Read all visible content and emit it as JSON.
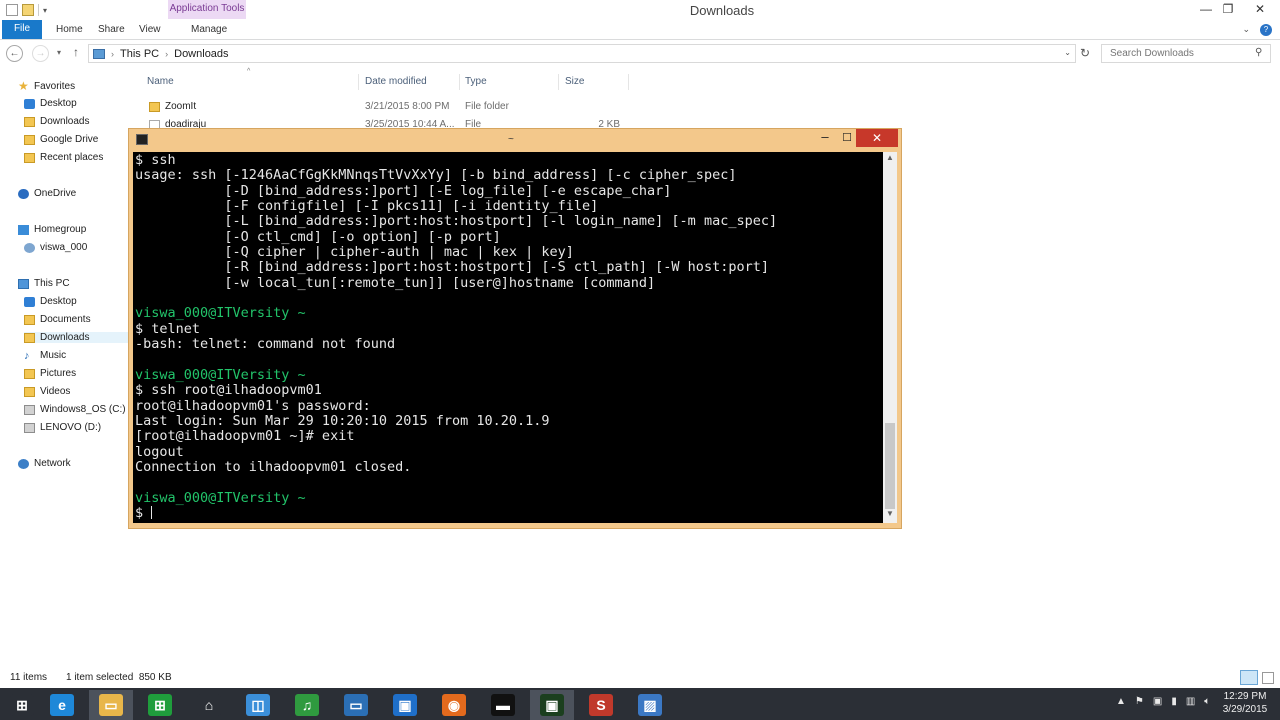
{
  "explorer": {
    "title": "Downloads",
    "contextual_tab": "Application Tools",
    "ribbon_tabs": [
      "File",
      "Home",
      "Share",
      "View",
      "Manage"
    ],
    "address": {
      "crumbs": [
        "This PC",
        "Downloads"
      ]
    },
    "search_placeholder": "Search Downloads",
    "nav": {
      "favorites": "Favorites",
      "fav_items": [
        "Desktop",
        "Downloads",
        "Google Drive",
        "Recent places"
      ],
      "onedrive": "OneDrive",
      "homegroup": "Homegroup",
      "homegroup_items": [
        "viswa_000"
      ],
      "thispc": "This PC",
      "pc_items": [
        "Desktop",
        "Documents",
        "Downloads",
        "Music",
        "Pictures",
        "Videos",
        "Windows8_OS (C:)",
        "LENOVO (D:)"
      ],
      "network": "Network"
    },
    "columns": [
      "Name",
      "Date modified",
      "Type",
      "Size"
    ],
    "rows": [
      {
        "name": "ZoomIt",
        "date": "3/21/2015 8:00 PM",
        "type": "File folder",
        "size": ""
      },
      {
        "name": "doadiraju",
        "date": "3/25/2015 10:44 A...",
        "type": "File",
        "size": "2 KB"
      }
    ],
    "status": {
      "count": "11 items",
      "selected": "1 item selected  850 KB"
    }
  },
  "terminal": {
    "title": "~",
    "lines": [
      {
        "text": "$ ssh",
        "color": "white"
      },
      {
        "text": "usage: ssh [-1246AaCfGgKkMNnqsTtVvXxYy] [-b bind_address] [-c cipher_spec]",
        "color": "white"
      },
      {
        "text": "           [-D [bind_address:]port] [-E log_file] [-e escape_char]",
        "color": "white"
      },
      {
        "text": "           [-F configfile] [-I pkcs11] [-i identity_file]",
        "color": "white"
      },
      {
        "text": "           [-L [bind_address:]port:host:hostport] [-l login_name] [-m mac_spec]",
        "color": "white"
      },
      {
        "text": "           [-O ctl_cmd] [-o option] [-p port]",
        "color": "white"
      },
      {
        "text": "           [-Q cipher | cipher-auth | mac | kex | key]",
        "color": "white"
      },
      {
        "text": "           [-R [bind_address:]port:host:hostport] [-S ctl_path] [-W host:port]",
        "color": "white"
      },
      {
        "text": "           [-w local_tun[:remote_tun]] [user@]hostname [command]",
        "color": "white"
      },
      {
        "text": "",
        "color": "white"
      },
      {
        "text": "viswa_000@ITVersity ~",
        "color": "green"
      },
      {
        "text": "$ telnet",
        "color": "white"
      },
      {
        "text": "-bash: telnet: command not found",
        "color": "white"
      },
      {
        "text": "",
        "color": "white"
      },
      {
        "text": "viswa_000@ITVersity ~",
        "color": "green"
      },
      {
        "text": "$ ssh root@ilhadoopvm01",
        "color": "white"
      },
      {
        "text": "root@ilhadoopvm01's password:",
        "color": "white"
      },
      {
        "text": "Last login: Sun Mar 29 10:20:10 2015 from 10.20.1.9",
        "color": "white"
      },
      {
        "text": "[root@ilhadoopvm01 ~]# exit",
        "color": "white"
      },
      {
        "text": "logout",
        "color": "white"
      },
      {
        "text": "Connection to ilhadoopvm01 closed.",
        "color": "white"
      },
      {
        "text": "",
        "color": "white"
      },
      {
        "text": "viswa_000@ITVersity ~",
        "color": "green"
      }
    ],
    "prompt": "$ "
  },
  "taskbar": {
    "clock_time": "12:29 PM",
    "clock_date": "3/29/2015",
    "apps": [
      {
        "icon": "windows-start-icon",
        "color": "#2b2f36"
      },
      {
        "icon": "internet-explorer-icon",
        "color": "#1e88d8"
      },
      {
        "icon": "file-explorer-icon",
        "color": "#e8b64a"
      },
      {
        "icon": "excel-store-icon",
        "color": "#1f9d3c"
      },
      {
        "icon": "home-icon",
        "color": "#2b2f36"
      },
      {
        "icon": "app-icon",
        "color": "#3b8fd9"
      },
      {
        "icon": "sound-app-icon",
        "color": "#2f9a3f"
      },
      {
        "icon": "remote-desktop-icon",
        "color": "#2b6fb5"
      },
      {
        "icon": "store-icon",
        "color": "#1f6fc9"
      },
      {
        "icon": "firefox-icon",
        "color": "#e36a1d"
      },
      {
        "icon": "command-prompt-icon",
        "color": "#111111"
      },
      {
        "icon": "terminal-icon",
        "color": "#1b3f1e"
      },
      {
        "icon": "snagit-icon",
        "color": "#c0392b"
      },
      {
        "icon": "presentation-icon",
        "color": "#3b78c4"
      }
    ]
  }
}
